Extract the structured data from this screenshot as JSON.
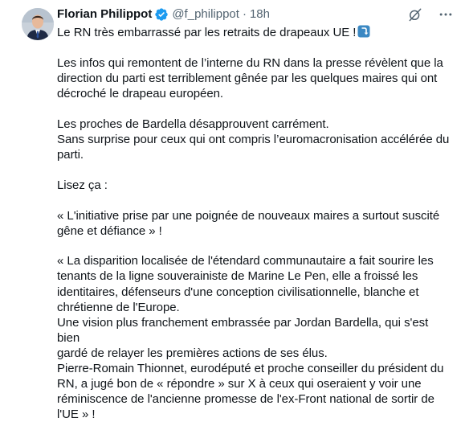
{
  "tweet": {
    "author_name": "Florian Philippot",
    "handle": "@f_philippot",
    "separator": "·",
    "time": "18h",
    "verified_color": "#1d9bf0",
    "icons": {
      "avatar": "profile-photo",
      "verified": "verified-badge-icon",
      "grok": "grok-icon",
      "more": "more-options-icon",
      "emoji": "right-arrow-curving-down-emoji"
    },
    "paragraphs": [
      [
        "Le RN très embarrassé par les retraits de drapeaux UE !"
      ],
      [
        "Les infos qui remontent de l’interne du RN dans la presse révèlent que la",
        "direction du parti est terriblement gênée par les quelques maires qui ont",
        "décroché le drapeau européen."
      ],
      [
        "Les proches de Bardella désapprouvent carrément.",
        "Sans surprise pour ceux qui ont compris l’euromacronisation accélérée du",
        "parti."
      ],
      [
        "Lisez ça :"
      ],
      [
        "« L'initiative prise par une poignée de nouveaux maires a surtout suscité",
        "gêne et défiance » !"
      ],
      [
        "« La disparition localisée de l'étendard communautaire a fait sourire les",
        "tenants de la ligne souverainiste de Marine Le Pen, elle a froissé les",
        "identitaires, défenseurs d'une conception civilisationnelle, blanche et",
        "chrétienne de l'Europe.",
        "Une vision plus franchement embrassée par Jordan Bardella, qui s'est bien",
        "gardé de relayer les premières actions de ses élus.",
        "Pierre-Romain Thionnet, eurodéputé et proche conseiller du président du",
        "RN, a jugé bon de « répondre » sur X à ceux qui oseraient y voir une",
        "réminiscence de l'ancienne promesse de l'ex-Front national de sortir de",
        "l'UE » !"
      ]
    ]
  }
}
